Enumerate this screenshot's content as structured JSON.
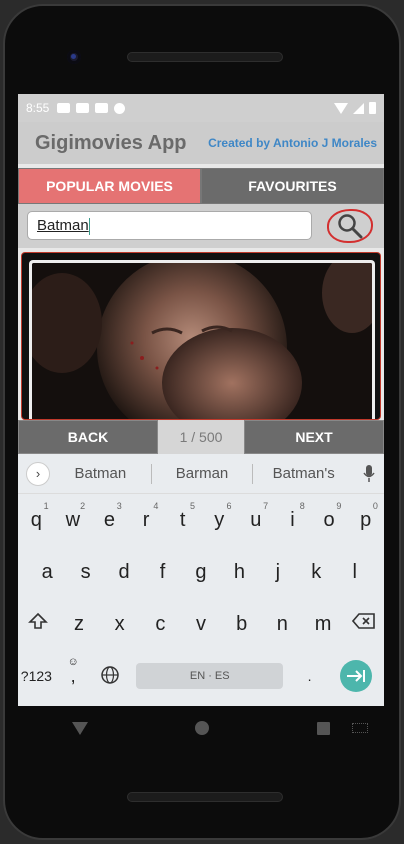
{
  "status_bar": {
    "time": "8:55"
  },
  "app_bar": {
    "title": "Gigimovies App",
    "credit": "Created by Antonio J Morales"
  },
  "tabs": [
    {
      "label": "POPULAR MOVIES",
      "active": true
    },
    {
      "label": "FAVOURITES",
      "active": false
    }
  ],
  "search": {
    "value": "Batman",
    "icon": "search-icon"
  },
  "pager": {
    "back_label": "BACK",
    "page_indicator": "1 / 500",
    "next_label": "NEXT"
  },
  "keyboard": {
    "suggestions": [
      "Batman",
      "Barman",
      "Batman's"
    ],
    "row1": [
      "q",
      "w",
      "e",
      "r",
      "t",
      "y",
      "u",
      "i",
      "o",
      "p"
    ],
    "row1_hints": [
      "1",
      "2",
      "3",
      "4",
      "5",
      "6",
      "7",
      "8",
      "9",
      "0"
    ],
    "row2": [
      "a",
      "s",
      "d",
      "f",
      "g",
      "h",
      "j",
      "k",
      "l"
    ],
    "row3": [
      "z",
      "x",
      "c",
      "v",
      "b",
      "n",
      "m"
    ],
    "symbols_label": "?123",
    "comma_label": ",",
    "space_label": "EN · ES",
    "period_label": "."
  },
  "colors": {
    "accent_tab": "#e57373",
    "credit_text": "#3f87c6",
    "enter_key": "#4db6ac",
    "search_highlight": "#d32f2f"
  }
}
